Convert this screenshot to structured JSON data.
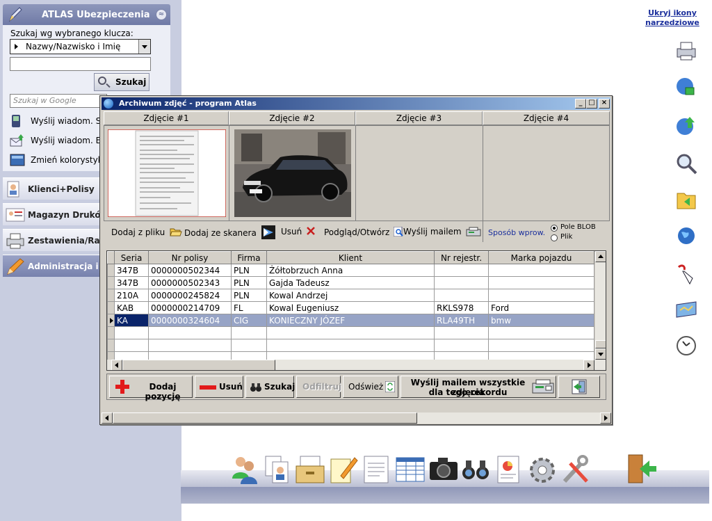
{
  "app": {
    "title": "ATLAS Ubezpieczenia",
    "collapse_symbol": "≈"
  },
  "search": {
    "key_label": "Szukaj wg wybranego klucza:",
    "key_value": "Nazwy/Nazwisko i Imię",
    "input_value": "",
    "search_button": "Szukaj",
    "google_placeholder": "Szukaj w Google"
  },
  "side_links": [
    {
      "label": "Wyślij wiadom. SMS",
      "icon": "sms-phone-icon"
    },
    {
      "label": "Wyślij wiadom. E-mail",
      "icon": "email-send-icon"
    },
    {
      "label": "Zmień kolorystykę",
      "icon": "color-scheme-icon"
    }
  ],
  "nav": [
    {
      "label": "Klienci+Polisy",
      "icon": "clients-policies-icon"
    },
    {
      "label": "Magazyn Druków",
      "icon": "forms-warehouse-icon"
    },
    {
      "label": "Zestawienia/Raporty",
      "icon": "printer-reports-icon"
    },
    {
      "label": "Administracja i inne",
      "icon": "administration-pencil-icon"
    }
  ],
  "right_toolbar": {
    "hide_link": "Ukryj ikony narzedziowe",
    "icons": [
      "printer-icon",
      "database-lock-icon",
      "globe-upload-icon",
      "magnifier-icon",
      "folder-back-icon",
      "globe-icon",
      "pointer-hand-icon",
      "map-card-icon",
      "clock-icon"
    ]
  },
  "dock_icons": [
    "users-icon",
    "documents-user-icon",
    "archive-drawer-icon",
    "edit-notepad-icon",
    "notes-icon",
    "spreadsheet-icon",
    "camera-icon",
    "binoculars-icon",
    "report-chart-icon",
    "gear-icon",
    "tools-icon",
    "exit-door-icon"
  ],
  "dialog": {
    "title": "Archiwum zdjęć - program  Atlas",
    "photo_headers": [
      "Zdjęcie #1",
      "Zdjęcie #2",
      "Zdjęcie #3",
      "Zdjęcie #4"
    ],
    "actions": {
      "from_file": "Dodaj z pliku",
      "from_scanner": "Dodaj ze skanera",
      "delete": "Usuń",
      "preview": "Podgląd/Otwórz",
      "email": "Wyślij mailem",
      "mode_label": "Sposób wprow.",
      "mode_blob": "Pole BLOB",
      "mode_file": "Plik"
    },
    "grid": {
      "columns": [
        "Seria",
        "Nr polisy",
        "Firma",
        "Klient",
        "Nr rejestr.",
        "Marka pojazdu"
      ],
      "rows": [
        [
          "347B",
          "0000000502344",
          "PLN",
          "Żółtobrzuch Anna",
          "",
          ""
        ],
        [
          "347B",
          "0000000502343",
          "PLN",
          "Gajda Tadeusz",
          "",
          ""
        ],
        [
          "210A",
          "0000000245824",
          "PLN",
          "Kowal Andrzej",
          "",
          ""
        ],
        [
          "KAB",
          "0000000214709",
          "FL",
          "Kowal Eugeniusz",
          "RKLS978",
          "Ford"
        ],
        [
          "KA",
          "0000000324604",
          "CIG",
          "KONIECZNY JÓZEF",
          "RLA49TH",
          "bmw"
        ]
      ]
    },
    "buttons": {
      "add": "Dodaj pozycję",
      "remove": "Usuń",
      "search": "Szukaj",
      "unfilter": "Odfiltruj",
      "refresh": "Odśwież",
      "email_all_1": "Wyślij mailem wszystkie zdjęcia",
      "email_all_2": "dla tego rekordu"
    }
  }
}
